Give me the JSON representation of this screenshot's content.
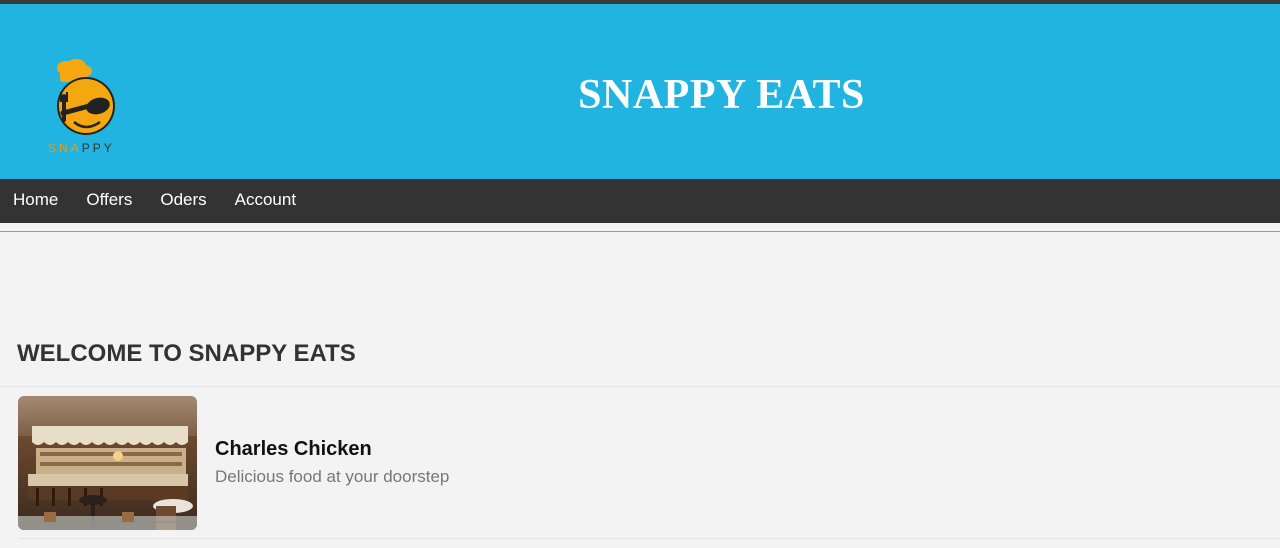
{
  "header": {
    "title": "SNAPPY EATS",
    "logo_text_highlight": "SNA",
    "logo_text_rest": "PPY",
    "background_color": "#21b4e0"
  },
  "nav": {
    "items": [
      {
        "label": "Home"
      },
      {
        "label": "Offers"
      },
      {
        "label": "Oders"
      },
      {
        "label": "Account"
      }
    ],
    "background_color": "#333333"
  },
  "main": {
    "welcome_heading": "WELCOME TO SNAPPY EATS",
    "restaurants": [
      {
        "name": "Charles Chicken",
        "description": "Delicious food at your doorstep",
        "image_icon": "restaurant-interior-photo"
      }
    ]
  }
}
